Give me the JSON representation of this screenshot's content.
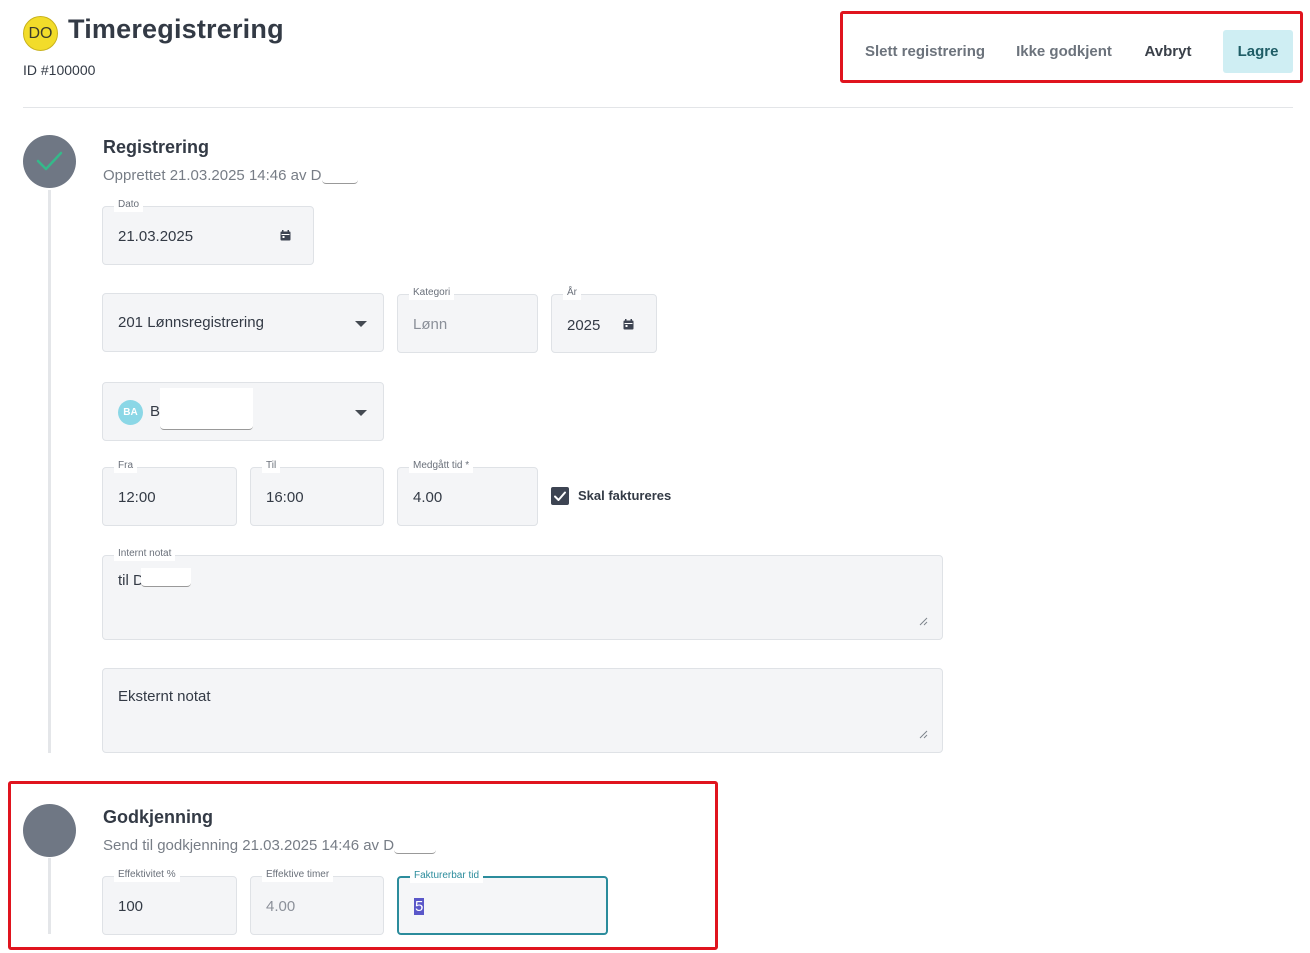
{
  "header": {
    "avatar_initials": "DO",
    "title": "Timeregistrering",
    "id_text": "ID #100000"
  },
  "toolbar": {
    "delete_label": "Slett registrering",
    "reject_label": "Ikke godkjent",
    "cancel_label": "Avbryt",
    "save_label": "Lagre"
  },
  "registration": {
    "title": "Registrering",
    "created_text": "Opprettet 21.03.2025 14:46 av D",
    "date_label": "Dato",
    "date_value": "21.03.2025",
    "activity_value": "201 Lønnsregistrering",
    "category_label": "Kategori",
    "category_value": "Lønn",
    "year_label": "År",
    "year_value": "2025",
    "person_initials": "BA",
    "person_name": "B",
    "from_label": "Fra",
    "from_value": "12:00",
    "to_label": "Til",
    "to_value": "16:00",
    "duration_label": "Medgått tid",
    "required_mark": "*",
    "duration_value": "4.00",
    "billable_checked": true,
    "billable_label": "Skal faktureres",
    "internal_note_label": "Internt notat",
    "internal_note_value": "til D",
    "external_note_placeholder": "Eksternt notat"
  },
  "approval": {
    "title": "Godkjenning",
    "sent_text": "Send til godkjenning 21.03.2025 14:46 av D",
    "efficiency_label": "Effektivitet %",
    "efficiency_value": "100",
    "effective_hours_label": "Effektive timer",
    "effective_hours_value": "4.00",
    "billable_time_label": "Fakturerbar tid",
    "billable_time_value": "5"
  },
  "colors": {
    "accent": "#2b8c9c",
    "save_bg": "#cfeef3",
    "highlight": "#e0141e",
    "step_dot": "#6f7784",
    "check": "#35b98a"
  }
}
